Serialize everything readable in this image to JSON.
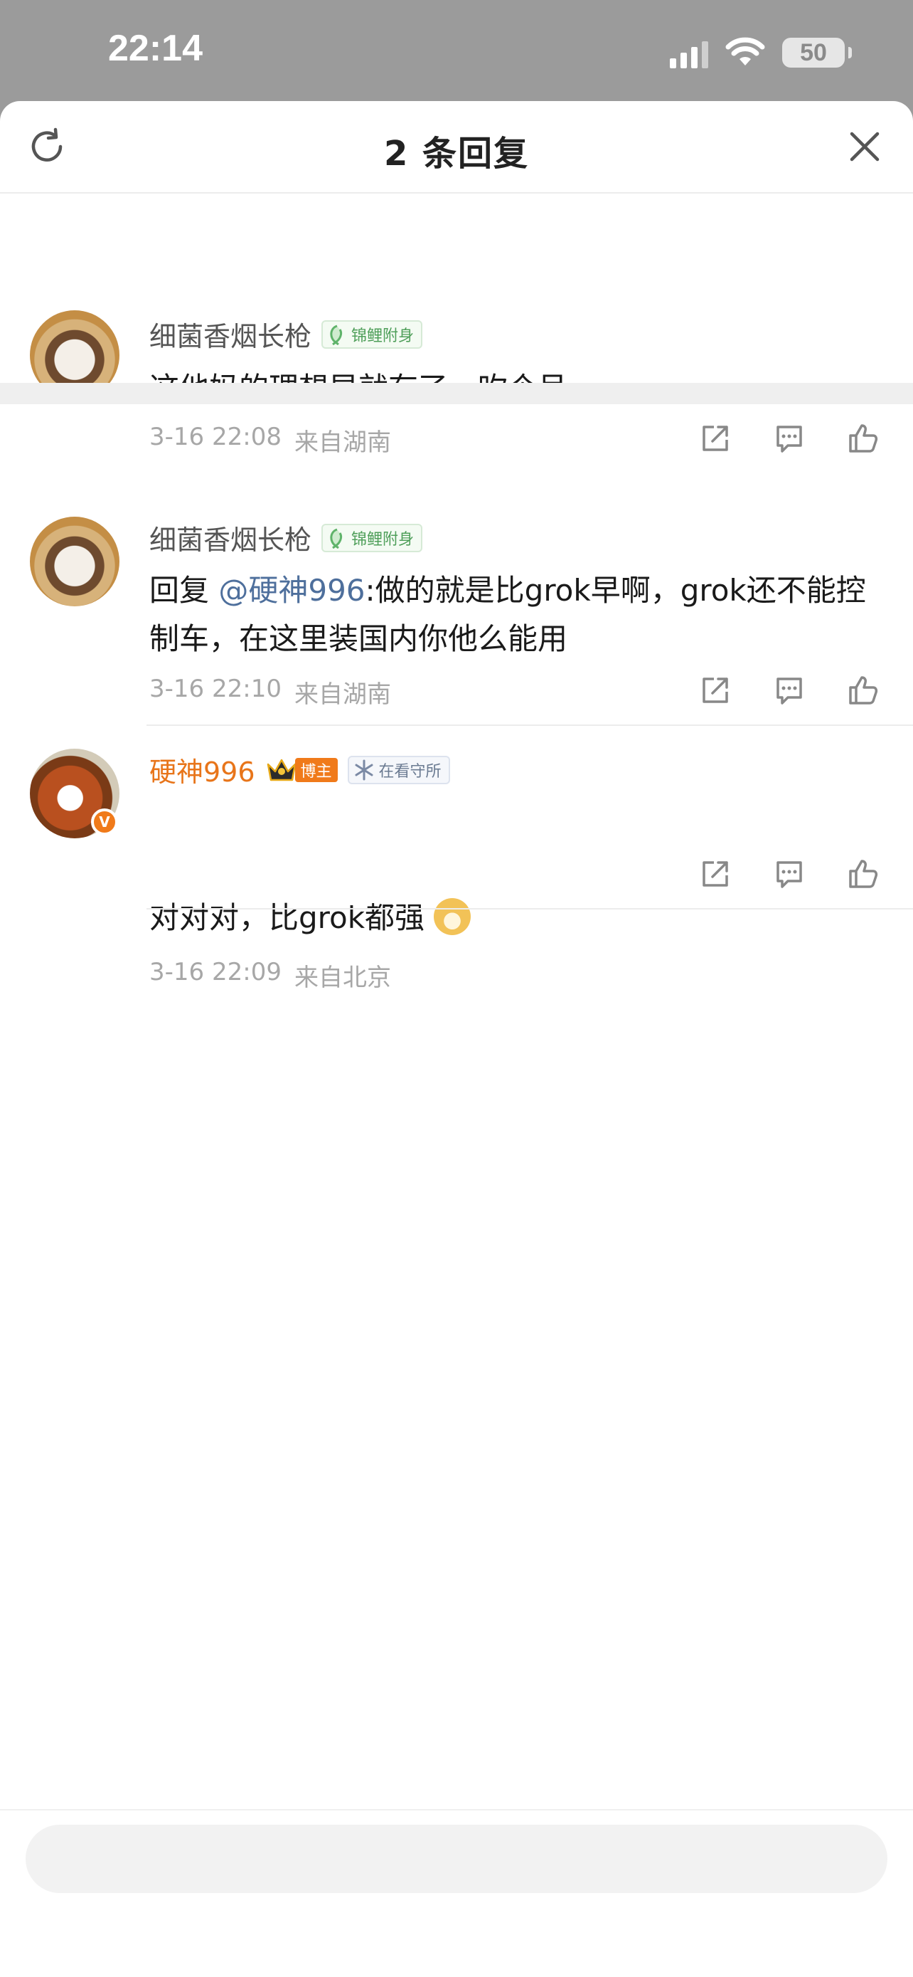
{
  "status_bar": {
    "time": "22:14",
    "battery": "50",
    "icons": [
      "signal-icon",
      "wifi-icon",
      "battery-icon"
    ]
  },
  "header": {
    "title": "2 条回复",
    "refresh_icon": "refresh-icon",
    "close_icon": "close-icon"
  },
  "comments": [
    {
      "username": "细菌香烟长枪",
      "tag": "锦鲤附身",
      "text": "这他妈的理想早就有了，吹个吊",
      "date": "3-16 22:08",
      "location": "来自湖南"
    },
    {
      "username": "细菌香烟长枪",
      "tag": "锦鲤附身",
      "reply_prefix": "回复 ",
      "mention": "@硬神996",
      "text": ":做的就是比grok早啊，grok还不能控制车，在这里装国内你他么能用",
      "date": "3-16 22:10",
      "location": "来自湖南"
    },
    {
      "username": "硬神996",
      "badge": "博主",
      "tag": "在看守所",
      "text": "对对对，比grok都强",
      "date": "3-16 22:09",
      "location": "来自北京"
    }
  ],
  "actions": [
    "share-icon",
    "comment-icon",
    "like-icon"
  ],
  "colors": {
    "accent_orange": "#e8751a",
    "mention_blue": "#4e6f9c",
    "tag_green": "#4f9f5a"
  }
}
